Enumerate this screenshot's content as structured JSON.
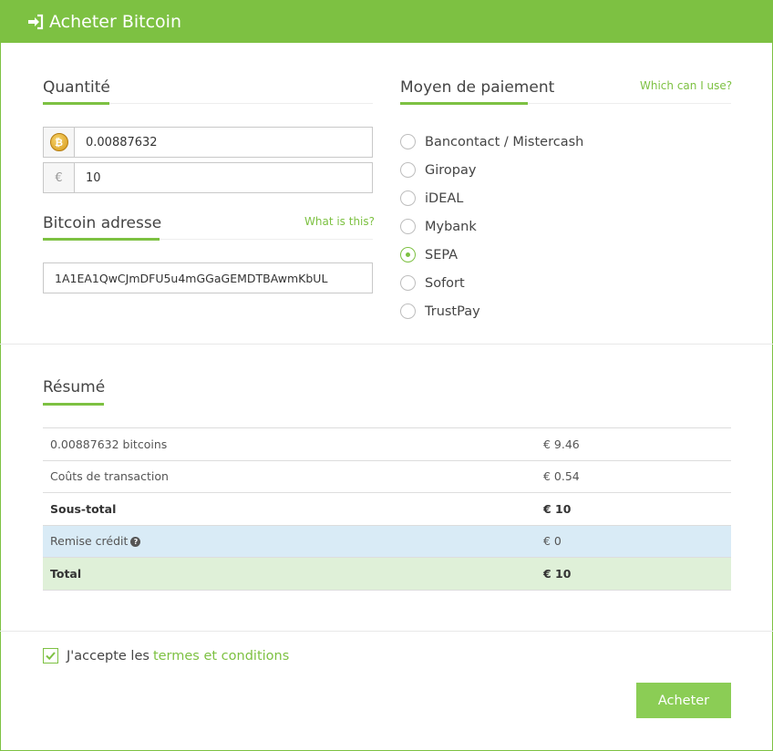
{
  "header": {
    "title": "Acheter Bitcoin",
    "icon": "sign-in-icon"
  },
  "quantity": {
    "title": "Quantité",
    "btc_value": "0.00887632",
    "eur_symbol": "€",
    "eur_value": "10"
  },
  "address": {
    "title": "Bitcoin adresse",
    "help_link": "What is this?",
    "value": "1A1EA1QwCJmDFU5u4mGGaGEMDTBAwmKbUL"
  },
  "payment": {
    "title": "Moyen de paiement",
    "help_link": "Which can I use?",
    "options": [
      {
        "label": "Bancontact / Mistercash",
        "checked": false
      },
      {
        "label": "Giropay",
        "checked": false
      },
      {
        "label": "iDEAL",
        "checked": false
      },
      {
        "label": "Mybank",
        "checked": false
      },
      {
        "label": "SEPA",
        "checked": true
      },
      {
        "label": "Sofort",
        "checked": false
      },
      {
        "label": "TrustPay",
        "checked": false
      }
    ]
  },
  "summary": {
    "title": "Résumé",
    "rows": [
      {
        "label": "0.00887632 bitcoins",
        "value": "€ 9.46"
      },
      {
        "label": "Coûts de transaction",
        "value": "€ 0.54"
      },
      {
        "label": "Sous-total",
        "value": "€ 10"
      },
      {
        "label": "Remise crédit",
        "value": "€ 0"
      },
      {
        "label": "Total",
        "value": "€ 10"
      }
    ]
  },
  "terms": {
    "checked": true,
    "prefix": "J'accepte les",
    "link": "termes et conditions"
  },
  "buy_button": "Acheter",
  "colors": {
    "accent": "#7dc142",
    "info_row": "#d9ebf6",
    "total_row": "#dff0d8"
  }
}
